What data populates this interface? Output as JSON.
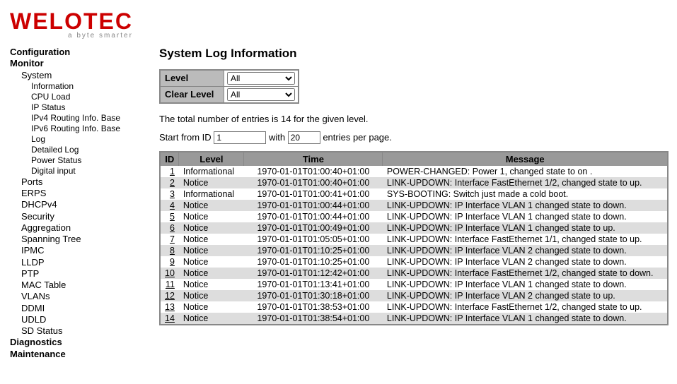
{
  "logo": {
    "main": "WELOTEC",
    "tag": "a byte smarter"
  },
  "nav": {
    "top": [
      "Configuration",
      "Monitor"
    ],
    "system": {
      "label": "System",
      "items": [
        "Information",
        "CPU Load",
        "IP Status",
        "IPv4 Routing Info. Base",
        "IPv6 Routing Info. Base",
        "Log",
        "Detailed Log",
        "Power Status",
        "Digital input"
      ]
    },
    "groups": [
      "Ports",
      "ERPS",
      "DHCPv4",
      "Security",
      "Aggregation",
      "Spanning Tree",
      "IPMC",
      "LLDP",
      "PTP",
      "MAC Table",
      "VLANs",
      "DDMI",
      "UDLD",
      "SD Status"
    ],
    "bottom": [
      "Diagnostics",
      "Maintenance"
    ]
  },
  "title": "System Log Information",
  "filter": {
    "level_label": "Level",
    "level_value": "All",
    "clear_label": "Clear Level",
    "clear_value": "All"
  },
  "status": "The total number of entries is 14 for the given level.",
  "pager": {
    "pre": "Start from ID",
    "id": "1",
    "mid": "with",
    "count": "20",
    "post": "entries per page."
  },
  "columns": [
    "ID",
    "Level",
    "Time",
    "Message"
  ],
  "rows": [
    {
      "id": "1",
      "level": "Informational",
      "time": "1970-01-01T01:00:40+01:00",
      "msg": "POWER-CHANGED: Power 1, changed state to on ."
    },
    {
      "id": "2",
      "level": "Notice",
      "time": "1970-01-01T01:00:40+01:00",
      "msg": "LINK-UPDOWN: Interface FastEthernet 1/2, changed state to up."
    },
    {
      "id": "3",
      "level": "Informational",
      "time": "1970-01-01T01:00:41+01:00",
      "msg": "SYS-BOOTING: Switch just made a cold boot."
    },
    {
      "id": "4",
      "level": "Notice",
      "time": "1970-01-01T01:00:44+01:00",
      "msg": "LINK-UPDOWN: IP Interface VLAN 1 changed state to down."
    },
    {
      "id": "5",
      "level": "Notice",
      "time": "1970-01-01T01:00:44+01:00",
      "msg": "LINK-UPDOWN: IP Interface VLAN 1 changed state to down."
    },
    {
      "id": "6",
      "level": "Notice",
      "time": "1970-01-01T01:00:49+01:00",
      "msg": "LINK-UPDOWN: IP Interface VLAN 1 changed state to up."
    },
    {
      "id": "7",
      "level": "Notice",
      "time": "1970-01-01T01:05:05+01:00",
      "msg": "LINK-UPDOWN: Interface FastEthernet 1/1, changed state to up."
    },
    {
      "id": "8",
      "level": "Notice",
      "time": "1970-01-01T01:10:25+01:00",
      "msg": "LINK-UPDOWN: IP Interface VLAN 2 changed state to down."
    },
    {
      "id": "9",
      "level": "Notice",
      "time": "1970-01-01T01:10:25+01:00",
      "msg": "LINK-UPDOWN: IP Interface VLAN 2 changed state to down."
    },
    {
      "id": "10",
      "level": "Notice",
      "time": "1970-01-01T01:12:42+01:00",
      "msg": "LINK-UPDOWN: Interface FastEthernet 1/2, changed state to down."
    },
    {
      "id": "11",
      "level": "Notice",
      "time": "1970-01-01T01:13:41+01:00",
      "msg": "LINK-UPDOWN: IP Interface VLAN 1 changed state to down."
    },
    {
      "id": "12",
      "level": "Notice",
      "time": "1970-01-01T01:30:18+01:00",
      "msg": "LINK-UPDOWN: IP Interface VLAN 2 changed state to up."
    },
    {
      "id": "13",
      "level": "Notice",
      "time": "1970-01-01T01:38:53+01:00",
      "msg": "LINK-UPDOWN: Interface FastEthernet 1/2, changed state to up."
    },
    {
      "id": "14",
      "level": "Notice",
      "time": "1970-01-01T01:38:54+01:00",
      "msg": "LINK-UPDOWN: IP Interface VLAN 1 changed state to down."
    }
  ]
}
